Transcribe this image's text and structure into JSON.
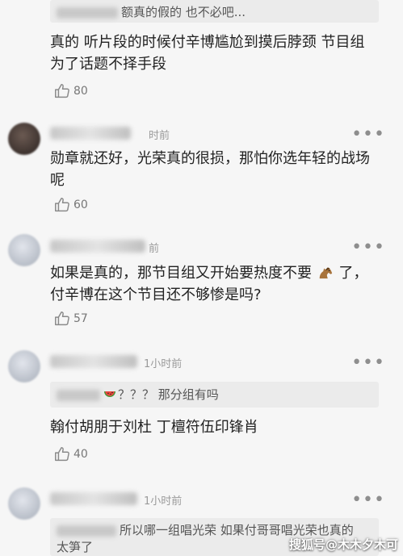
{
  "comment0": {
    "quote_text": "额真的假的 也不必吧...",
    "body": "真的 听片段的时候付辛博尴尬到摸后脖颈 节目组为了话题不择手段",
    "likes": "80"
  },
  "comment1": {
    "time": "时前",
    "body": "勋章就还好，光荣真的很损，那怕你选年轻的战场呢",
    "likes": "60"
  },
  "comment2": {
    "time": "前",
    "body_line1": "如果是真的，那节目组又开始要热度不要",
    "body_line1_end": "了，",
    "body_line2": "付辛博在这个节目还不够惨是吗?",
    "likes": "57"
  },
  "comment3": {
    "time": "1小时前",
    "quote_text": "？？？ 那分组有吗",
    "body": "翰付胡朋于刘杜 丁檀符伍印锋肖",
    "likes": "40"
  },
  "comment4": {
    "time": "1小时前",
    "quote_line1": "所以哪一组唱光荣 如果付哥哥唱光荣也真的",
    "quote_line2": "太笋了"
  },
  "watermark": "搜狐号@木木夕木可",
  "colors": {
    "like_icon": "#8a8a8a",
    "background": "#f6f6f6"
  }
}
